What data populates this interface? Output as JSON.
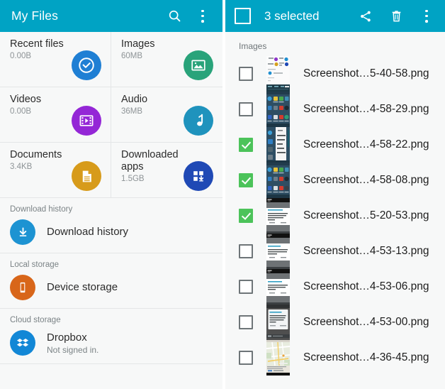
{
  "left": {
    "appbar": {
      "title": "My Files",
      "search_icon": "search-icon",
      "overflow_icon": "more-vert-icon"
    },
    "categories": [
      {
        "name": "Recent files",
        "size": "0.00B",
        "icon": "recent-clock-icon",
        "color": "#1f7fd4"
      },
      {
        "name": "Images",
        "size": "60MB",
        "icon": "image-icon",
        "color": "#29a37a"
      },
      {
        "name": "Videos",
        "size": "0.00B",
        "icon": "video-film-icon",
        "color": "#9427d6"
      },
      {
        "name": "Audio",
        "size": "36MB",
        "icon": "music-note-icon",
        "color": "#1f93bd"
      },
      {
        "name": "Documents",
        "size": "3.4KB",
        "icon": "document-icon",
        "color": "#d79b1b"
      },
      {
        "name": "Downloaded apps",
        "size": "1.5GB",
        "icon": "apps-download-icon",
        "color": "#1f49b5"
      }
    ],
    "sections": [
      {
        "header": "Download history",
        "row_title": "Download history",
        "row_sub": "",
        "icon": "download-circle-icon",
        "color": "#1d93d2"
      },
      {
        "header": "Local storage",
        "row_title": "Device storage",
        "row_sub": "",
        "icon": "phone-icon",
        "color": "#d8661a"
      },
      {
        "header": "Cloud storage",
        "row_title": "Dropbox",
        "row_sub": "Not signed in.",
        "icon": "dropbox-icon",
        "color": "#1287d6"
      }
    ]
  },
  "right": {
    "appbar": {
      "select_all_checkbox": "select-all-checkbox",
      "count_label": "3 selected",
      "share_icon": "share-icon",
      "delete_icon": "trash-icon",
      "overflow_icon": "more-vert-icon"
    },
    "list_label": "Images",
    "files": [
      {
        "name": "Screenshot…5-40-58.png",
        "checked": false,
        "thumb": "myfiles-app"
      },
      {
        "name": "Screenshot…4-58-29.png",
        "checked": false,
        "thumb": "home-screen"
      },
      {
        "name": "Screenshot…4-58-22.png",
        "checked": true,
        "thumb": "menu-list"
      },
      {
        "name": "Screenshot…4-58-08.png",
        "checked": true,
        "thumb": "home-screen"
      },
      {
        "name": "Screenshot…5-20-53.png",
        "checked": true,
        "thumb": "web-page"
      },
      {
        "name": "Screenshot…4-53-13.png",
        "checked": false,
        "thumb": "web-page"
      },
      {
        "name": "Screenshot…4-53-06.png",
        "checked": false,
        "thumb": "web-page"
      },
      {
        "name": "Screenshot…4-53-00.png",
        "checked": false,
        "thumb": "dialog"
      },
      {
        "name": "Screenshot…4-36-45.png",
        "checked": false,
        "thumb": "map"
      }
    ]
  },
  "colors": {
    "appbar": "#00a3c4",
    "checked_green": "#4cc35a",
    "panel_bg": "#f7f8f8"
  }
}
